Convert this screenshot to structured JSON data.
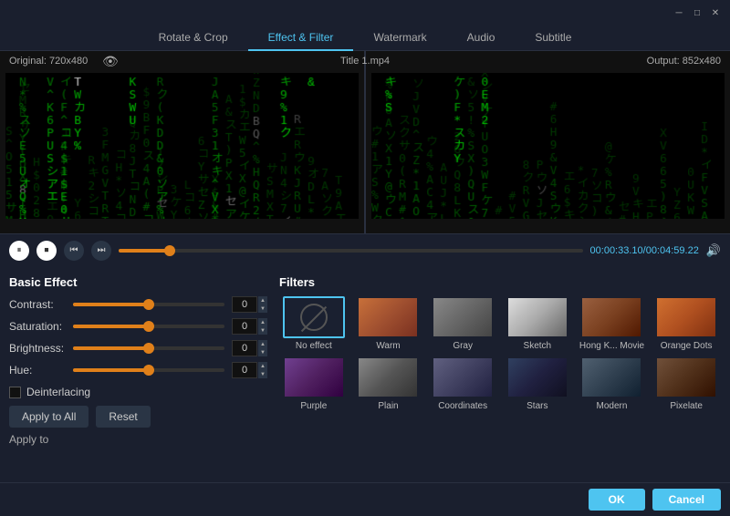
{
  "titleBar": {
    "minimizeLabel": "─",
    "maximizeLabel": "□",
    "closeLabel": "✕"
  },
  "tabs": [
    {
      "id": "rotate",
      "label": "Rotate & Crop",
      "active": false
    },
    {
      "id": "effect",
      "label": "Effect & Filter",
      "active": true
    },
    {
      "id": "watermark",
      "label": "Watermark",
      "active": false
    },
    {
      "id": "audio",
      "label": "Audio",
      "active": false
    },
    {
      "id": "subtitle",
      "label": "Subtitle",
      "active": false
    }
  ],
  "videoArea": {
    "originalLabel": "Original: 720x480",
    "titleLabel": "Title 1.mp4",
    "outputLabel": "Output: 852x480"
  },
  "controls": {
    "timeDisplay": "00:00:33.10/00:04:59.22",
    "progressPercent": 11
  },
  "basicEffect": {
    "title": "Basic Effect",
    "contrast": {
      "label": "Contrast:",
      "value": "0",
      "fillPercent": 50,
      "color": "#e0801a"
    },
    "saturation": {
      "label": "Saturation:",
      "value": "0",
      "fillPercent": 50,
      "color": "#e0801a"
    },
    "brightness": {
      "label": "Brightness:",
      "value": "0",
      "fillPercent": 50,
      "color": "#e0801a"
    },
    "hue": {
      "label": "Hue:",
      "value": "0",
      "fillPercent": 50,
      "color": "#e0801a"
    },
    "deinterlacing": {
      "label": "Deinterlacing",
      "checked": false
    },
    "applyToAll": "Apply to All",
    "reset": "Reset",
    "applyTo": "Apply to"
  },
  "filters": {
    "title": "Filters",
    "items": [
      {
        "id": "no-effect",
        "label": "No effect",
        "selected": true,
        "type": "no-effect"
      },
      {
        "id": "warm",
        "label": "Warm",
        "selected": false,
        "type": "warm"
      },
      {
        "id": "gray",
        "label": "Gray",
        "selected": false,
        "type": "gray"
      },
      {
        "id": "sketch",
        "label": "Sketch",
        "selected": false,
        "type": "sketch"
      },
      {
        "id": "hk-movie",
        "label": "Hong K... Movie",
        "selected": false,
        "type": "hk-movie"
      },
      {
        "id": "orange-dots",
        "label": "Orange Dots",
        "selected": false,
        "type": "orange-dots"
      },
      {
        "id": "purple",
        "label": "Purple",
        "selected": false,
        "type": "purple"
      },
      {
        "id": "plain",
        "label": "Plain",
        "selected": false,
        "type": "plain"
      },
      {
        "id": "coordinates",
        "label": "Coordinates",
        "selected": false,
        "type": "coordinates"
      },
      {
        "id": "stars",
        "label": "Stars",
        "selected": false,
        "type": "stars"
      },
      {
        "id": "modern",
        "label": "Modern",
        "selected": false,
        "type": "modern"
      },
      {
        "id": "pixelate",
        "label": "Pixelate",
        "selected": false,
        "type": "pixelate"
      }
    ]
  },
  "bottomBar": {
    "okLabel": "OK",
    "cancelLabel": "Cancel"
  }
}
